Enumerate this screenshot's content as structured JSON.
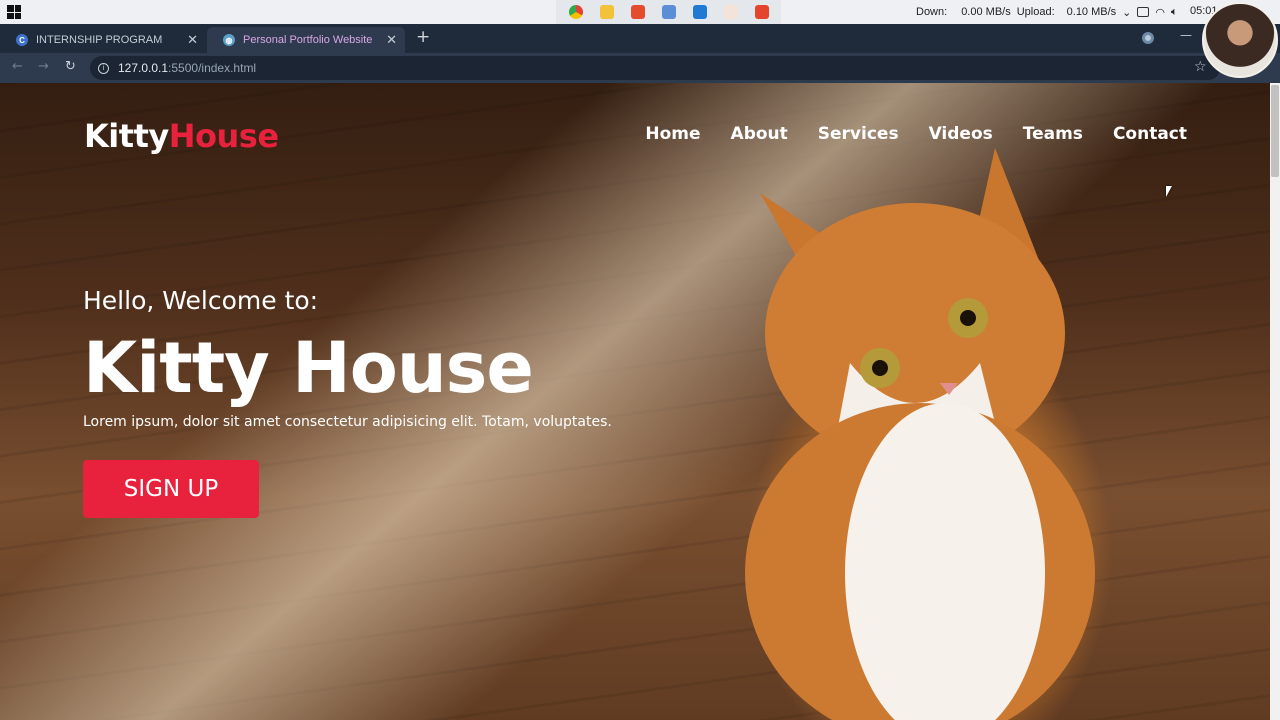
{
  "taskbar": {
    "down_label": "Down:",
    "down_value": "0.00 MB/s",
    "upload_label": "Upload:",
    "upload_value": "0.10 MB/s",
    "clock": "05:01"
  },
  "browser": {
    "tabs": [
      {
        "title": "INTERNSHIP PROGRAM",
        "favicon": "C",
        "active": false
      },
      {
        "title": "Personal Portfolio Website",
        "favicon": "globe-icon",
        "active": true
      }
    ],
    "url_host": "127.0.0.1",
    "url_rest": ":5500/index.html"
  },
  "site": {
    "logo_white": "Kitty",
    "logo_red": "House",
    "nav": [
      "Home",
      "About",
      "Services",
      "Videos",
      "Teams",
      "Contact"
    ],
    "hero": {
      "greeting": "Hello, Welcome to:",
      "title": "Kitty House",
      "subtitle": "Lorem ipsum, dolor sit amet consectetur adipisicing elit. Totam, voluptates.",
      "button": "SIGN UP"
    }
  },
  "colors": {
    "accent": "#e8213c",
    "tab_bar": "#1f2b3a",
    "address_bar": "#2e3b4e"
  }
}
